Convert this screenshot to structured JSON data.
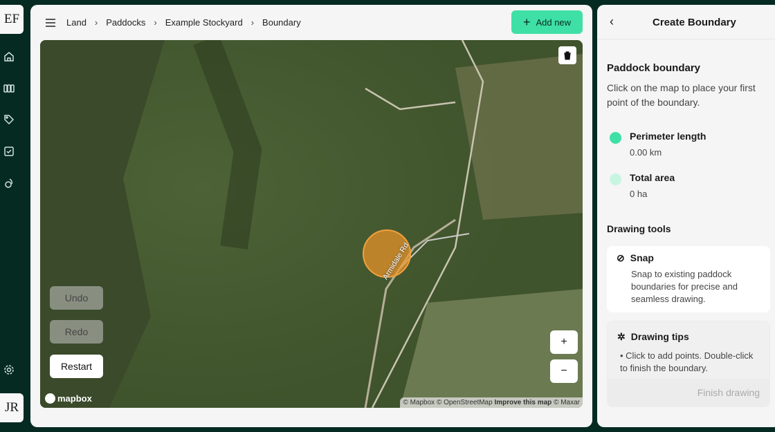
{
  "rail": {
    "logo": "EF",
    "avatar": "JR",
    "items": [
      "home-icon",
      "paddocks-icon",
      "tag-icon",
      "tasks-icon",
      "water-icon"
    ],
    "settings": "gear-icon"
  },
  "header": {
    "breadcrumbs": [
      "Land",
      "Paddocks",
      "Example Stockyard",
      "Boundary"
    ],
    "add_new": "Add new"
  },
  "map": {
    "undo": "Undo",
    "redo": "Redo",
    "restart": "Restart",
    "zoom_in": "+",
    "zoom_out": "−",
    "road_label": "Armidale Rd",
    "logo": "mapbox",
    "attribution": {
      "a": "© Mapbox © OpenStreetMap",
      "b": "Improve this map",
      "c": "© Maxar"
    }
  },
  "panel": {
    "title": "Create Boundary",
    "section_title": "Paddock boundary",
    "description": "Click on the map to place your first point of the boundary.",
    "perimeter": {
      "label": "Perimeter length",
      "value": "0.00 km",
      "color": "#3ee0a6"
    },
    "area": {
      "label": "Total area",
      "value": "0 ha",
      "color": "#c7f5e2"
    },
    "tools_title": "Drawing tools",
    "snap": {
      "title": "Snap",
      "text1": "Snap to existing paddock boundaries for",
      "text2": "precise and seamless drawing."
    },
    "tips": {
      "title": "Drawing tips",
      "text1": "• Click to add points. Double-click to finish the",
      "text2": "boundary."
    },
    "finish": "Finish drawing"
  },
  "colors": {
    "accent": "#3ee0a6",
    "rail": "#052a22",
    "marker": "#f0962a"
  }
}
